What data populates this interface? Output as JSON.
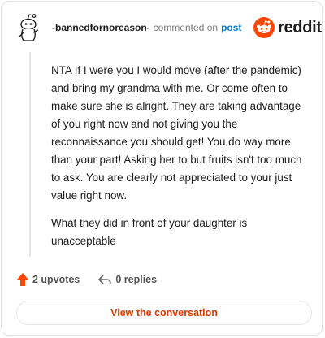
{
  "comment": {
    "author": "-bannedfornoreason-",
    "action_text": "commented on",
    "post_link_text": "post",
    "paragraphs": [
      "NTA If I were you I would move (after the pandemic) and bring my grandma with me. Or come often to make sure she is alright. They are taking advantage of you right now and not giving you the reconnaissance you should get! You do way more than your part! Asking her to but fruits isn't too much to ask. You are clearly not appreciated to your just value right now.",
      "What they did in front of your daughter is unacceptable"
    ]
  },
  "brand": {
    "name": "reddit",
    "accent_color": "#ff4500",
    "icon": "reddit-snoo-icon"
  },
  "footer": {
    "upvotes_label": "2 upvotes",
    "replies_label": "0 replies",
    "upvote_icon": "upvote-arrow-icon",
    "reply_icon": "reply-arrow-icon"
  },
  "cta": {
    "label": "View the conversation",
    "color": "#d93a00"
  },
  "avatar": {
    "icon": "snoo-avatar-icon"
  }
}
